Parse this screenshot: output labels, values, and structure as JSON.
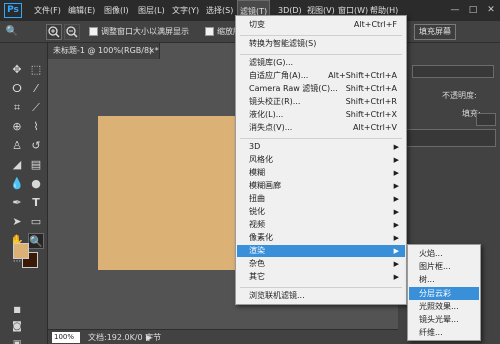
{
  "app": {
    "logo": "Ps"
  },
  "menubar": {
    "items": [
      "文件(F)",
      "编辑(E)",
      "图像(I)",
      "图层(L)",
      "文字(Y)",
      "选择(S)",
      "滤镜(T)",
      "3D(D)",
      "视图(V)",
      "窗口(W)",
      "帮助(H)"
    ],
    "active_index": 6
  },
  "window_controls": {
    "minimize": "—",
    "maximize": "□",
    "close": "✕"
  },
  "options": {
    "checkbox1": "调整窗口大小以满屏显示",
    "checkbox2": "缩放所有窗",
    "fill_screen": "填充屏幕"
  },
  "document": {
    "tab_title": "未标题-1 @ 100%(RGB/8) *",
    "tab_close": "×"
  },
  "status": {
    "zoom": "100%",
    "doc_info": "文档:192.0K/0 字节",
    "arrow": "▶"
  },
  "right_panel": {
    "opacity_label": "不透明度:",
    "fill_label": "填充:"
  },
  "colors": {
    "foreground": "#dcb176",
    "background": "#3a1a06",
    "canvas": "#dcb176",
    "accent": "#3a8fd9"
  },
  "filter_menu": {
    "items": [
      {
        "label": "切变",
        "shortcut": "Alt+Ctrl+F"
      },
      {
        "label": "转换为智能滤镜(S)"
      },
      {
        "label": "滤镜库(G)..."
      },
      {
        "label": "自适应广角(A)...",
        "shortcut": "Alt+Shift+Ctrl+A"
      },
      {
        "label": "Camera Raw 滤镜(C)...",
        "shortcut": "Shift+Ctrl+A"
      },
      {
        "label": "镜头校正(R)...",
        "shortcut": "Shift+Ctrl+R"
      },
      {
        "label": "液化(L)...",
        "shortcut": "Shift+Ctrl+X"
      },
      {
        "label": "消失点(V)...",
        "shortcut": "Alt+Ctrl+V"
      },
      {
        "label": "3D",
        "arrow": "▶"
      },
      {
        "label": "风格化",
        "arrow": "▶"
      },
      {
        "label": "模糊",
        "arrow": "▶"
      },
      {
        "label": "模糊画廊",
        "arrow": "▶"
      },
      {
        "label": "扭曲",
        "arrow": "▶"
      },
      {
        "label": "锐化",
        "arrow": "▶"
      },
      {
        "label": "视频",
        "arrow": "▶"
      },
      {
        "label": "像素化",
        "arrow": "▶"
      },
      {
        "label": "渲染",
        "arrow": "▶"
      },
      {
        "label": "杂色",
        "arrow": "▶"
      },
      {
        "label": "其它",
        "arrow": "▶"
      },
      {
        "label": "浏览联机滤镜..."
      }
    ],
    "highlighted_index": 16
  },
  "render_submenu": {
    "items": [
      "火焰...",
      "图片框...",
      "树...",
      "分层云彩",
      "光照效果...",
      "镜头光晕...",
      "纤维..."
    ],
    "highlighted_index": 3
  }
}
